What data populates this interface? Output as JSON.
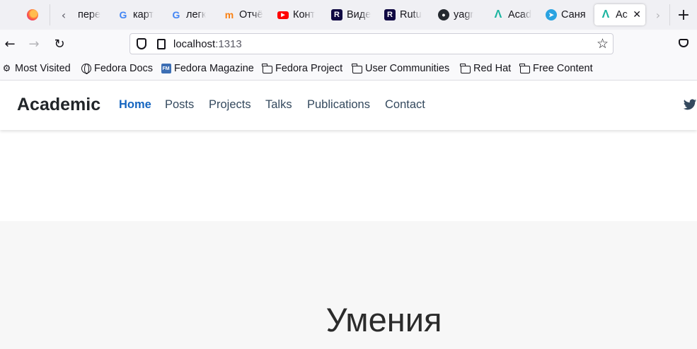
{
  "browser": {
    "tabs": [
      {
        "label": "пере",
        "icon": "tab-scroll-overflow-icon"
      },
      {
        "label": "карт",
        "icon": "google-icon"
      },
      {
        "label": "легк",
        "icon": "google-icon"
      },
      {
        "label": "Отчё",
        "icon": "moodle-icon"
      },
      {
        "label": "Конт",
        "icon": "youtube-icon"
      },
      {
        "label": "Виде",
        "icon": "rutube-icon"
      },
      {
        "label": "Rutu",
        "icon": "rutube-icon"
      },
      {
        "label": "yagr",
        "icon": "github-icon"
      },
      {
        "label": "Acad",
        "icon": "academic-icon"
      },
      {
        "label": "Саня",
        "icon": "telegram-icon"
      },
      {
        "label": "Ac",
        "icon": "academic-icon",
        "active": true
      }
    ],
    "url": {
      "host": "localhost",
      "port": ":1313"
    },
    "bookmarks": [
      {
        "label": "Most Visited",
        "icon": "gear-icon"
      },
      {
        "label": "Fedora Docs",
        "icon": "globe-icon"
      },
      {
        "label": "Fedora Magazine",
        "icon": "fedora-magazine-icon"
      },
      {
        "label": "Fedora Project",
        "icon": "folder-icon"
      },
      {
        "label": "User Communities",
        "icon": "folder-icon"
      },
      {
        "label": "Red Hat",
        "icon": "folder-icon"
      },
      {
        "label": "Free Content",
        "icon": "folder-icon"
      }
    ]
  },
  "site": {
    "brand": "Academic",
    "menu": [
      "Home",
      "Posts",
      "Projects",
      "Talks",
      "Publications",
      "Contact"
    ],
    "active_menu": "Home",
    "skills_title": "Умения",
    "accent_color": "#1565c0"
  }
}
